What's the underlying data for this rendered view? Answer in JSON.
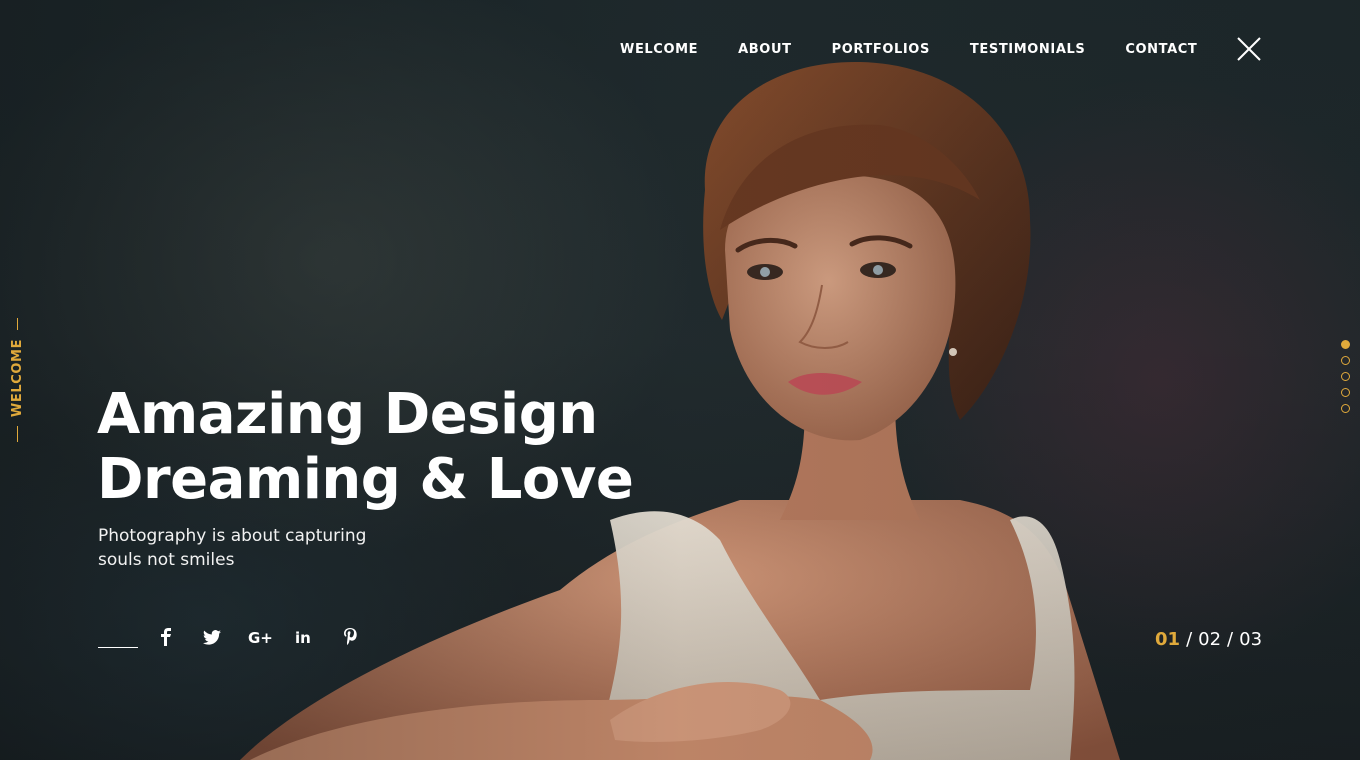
{
  "nav": {
    "items": [
      {
        "label": "WELCOME"
      },
      {
        "label": "ABOUT"
      },
      {
        "label": "PORTFOLIOS"
      },
      {
        "label": "TESTIMONIALS"
      },
      {
        "label": "CONTACT"
      }
    ],
    "close_icon": "close-icon"
  },
  "side_label": "WELCOME",
  "hero": {
    "headline_line1": "Amazing Design",
    "headline_line2": "Dreaming & Love",
    "subtext_line1": "Photography is about capturing",
    "subtext_line2": "souls not smiles"
  },
  "social": {
    "icons": [
      {
        "name": "facebook-icon",
        "glyph": "f"
      },
      {
        "name": "twitter-icon",
        "glyph": "🐦"
      },
      {
        "name": "google-plus-icon",
        "glyph": "G+"
      },
      {
        "name": "linkedin-icon",
        "glyph": "in"
      },
      {
        "name": "pinterest-icon",
        "glyph": "p"
      }
    ]
  },
  "slider": {
    "dot_count": 5,
    "active_dot": 1,
    "current": "01",
    "second": "02",
    "third": "03",
    "separator": "/"
  },
  "colors": {
    "accent": "#e0a93b",
    "text": "#ffffff"
  }
}
